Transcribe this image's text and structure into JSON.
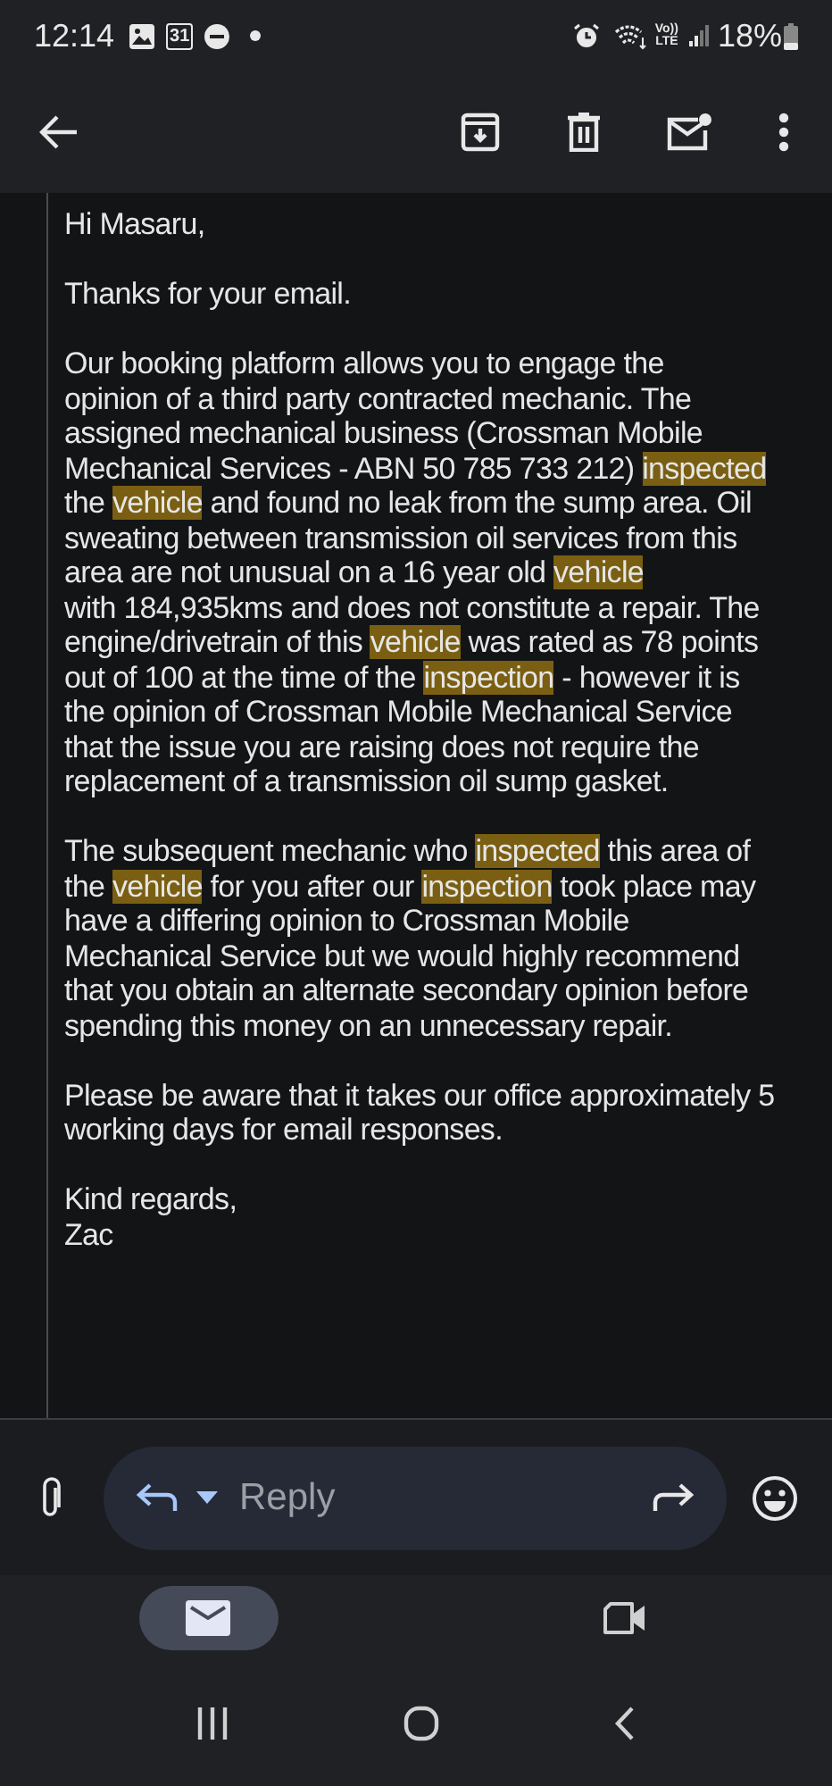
{
  "status_bar": {
    "time": "12:14",
    "calendar_day": "31",
    "volte_top": "Vo))",
    "volte_bottom": "LTE",
    "battery": "18%"
  },
  "email": {
    "paragraphs": [
      {
        "lines": [
          [
            {
              "text": "Hi Masaru,",
              "highlighted": false
            }
          ]
        ]
      },
      {
        "lines": [
          [
            {
              "text": "Thanks for your email.",
              "highlighted": false
            }
          ]
        ]
      },
      {
        "lines": [
          [
            {
              "text": "Our booking platform allows you to engage the",
              "highlighted": false
            }
          ],
          [
            {
              "text": "opinion of a third party contracted mechanic. The",
              "highlighted": false
            }
          ],
          [
            {
              "text": "assigned mechanical business (Crossman Mobile",
              "highlighted": false
            }
          ],
          [
            {
              "text": "Mechanical Services - ABN 50 785 733 212) ",
              "highlighted": false
            },
            {
              "text": "inspected",
              "highlighted": true
            }
          ],
          [
            {
              "text": "the ",
              "highlighted": false
            },
            {
              "text": "vehicle",
              "highlighted": true
            },
            {
              "text": " and found no leak from the sump area. Oil",
              "highlighted": false
            }
          ],
          [
            {
              "text": "sweating between transmission oil services from this",
              "highlighted": false
            }
          ],
          [
            {
              "text": "area are not unusual on a 16 year old ",
              "highlighted": false
            },
            {
              "text": "vehicle",
              "highlighted": true
            }
          ],
          [
            {
              "text": "with 184,935kms and does not constitute a repair. The",
              "highlighted": false
            }
          ],
          [
            {
              "text": "engine/drivetrain of this ",
              "highlighted": false
            },
            {
              "text": "vehicle",
              "highlighted": true
            },
            {
              "text": " was rated as 78 points",
              "highlighted": false
            }
          ],
          [
            {
              "text": "out of 100 at the time of the ",
              "highlighted": false
            },
            {
              "text": "inspection",
              "highlighted": true
            },
            {
              "text": " - however it is",
              "highlighted": false
            }
          ],
          [
            {
              "text": "the opinion of Crossman Mobile Mechanical Service",
              "highlighted": false
            }
          ],
          [
            {
              "text": "that the issue you are raising does not require the",
              "highlighted": false
            }
          ],
          [
            {
              "text": "replacement of a transmission oil sump gasket.",
              "highlighted": false
            }
          ]
        ]
      },
      {
        "lines": [
          [
            {
              "text": "The subsequent mechanic who ",
              "highlighted": false
            },
            {
              "text": "inspected",
              "highlighted": true
            },
            {
              "text": " this area of",
              "highlighted": false
            }
          ],
          [
            {
              "text": "the ",
              "highlighted": false
            },
            {
              "text": "vehicle",
              "highlighted": true
            },
            {
              "text": " for you after our ",
              "highlighted": false
            },
            {
              "text": "inspection",
              "highlighted": true
            },
            {
              "text": " took place may",
              "highlighted": false
            }
          ],
          [
            {
              "text": "have a differing opinion to Crossman Mobile",
              "highlighted": false
            }
          ],
          [
            {
              "text": "Mechanical Service but we would highly recommend",
              "highlighted": false
            }
          ],
          [
            {
              "text": "that you obtain an alternate secondary opinion before",
              "highlighted": false
            }
          ],
          [
            {
              "text": "spending this money on an unnecessary repair.",
              "highlighted": false
            }
          ]
        ]
      },
      {
        "lines": [
          [
            {
              "text": "Please be aware that it takes our office approximately 5",
              "highlighted": false
            }
          ],
          [
            {
              "text": "working days for email responses.",
              "highlighted": false
            }
          ]
        ]
      },
      {
        "lines": [
          [
            {
              "text": "Kind regards,",
              "highlighted": false
            }
          ],
          [
            {
              "text": "Zac",
              "highlighted": false
            }
          ]
        ]
      }
    ]
  },
  "reply_bar": {
    "placeholder": "Reply"
  },
  "bottom_nav": [
    {
      "kind": "mail",
      "selected": true
    },
    {
      "kind": "video",
      "selected": false
    }
  ]
}
